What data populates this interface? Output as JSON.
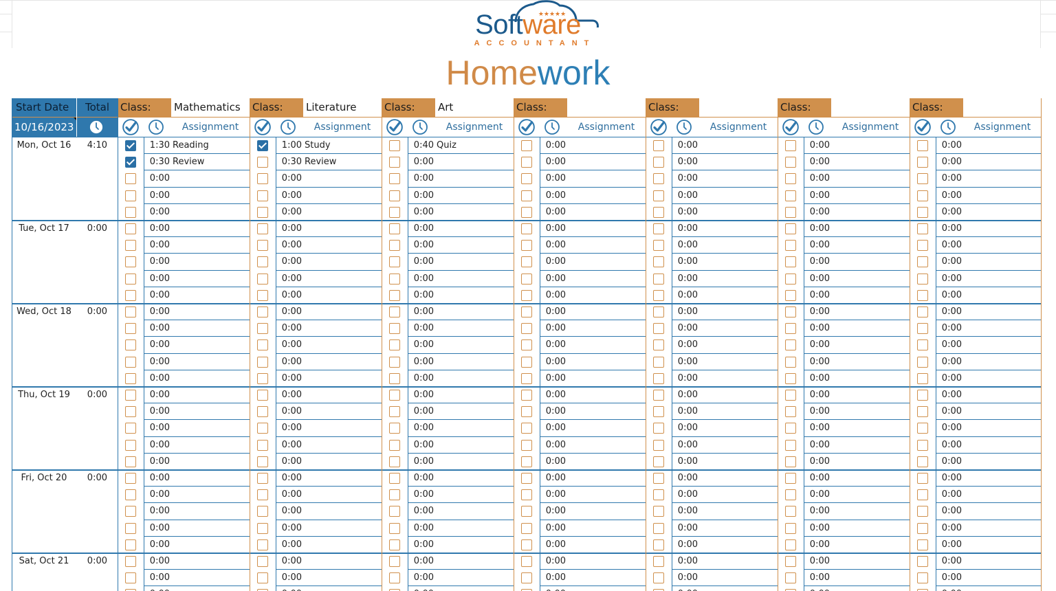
{
  "logo": {
    "word_blue": "Soft",
    "word_orange": "ware",
    "sub": "ACCOUNTANT"
  },
  "title": {
    "part1": "Home",
    "part2": "work"
  },
  "header": {
    "start_date_label": "Start Date",
    "total_label": "Total",
    "start_date_value": "10/16/2023"
  },
  "class_label": "Class:",
  "assignment_label": "Assignment",
  "classes": [
    "Mathematics",
    "Literature",
    "Art",
    "",
    "",
    "",
    ""
  ],
  "days": [
    {
      "label": "Mon, Oct 16",
      "total": "4:10"
    },
    {
      "label": "Tue, Oct 17",
      "total": "0:00"
    },
    {
      "label": "Wed, Oct 18",
      "total": "0:00"
    },
    {
      "label": "Thu, Oct 19",
      "total": "0:00"
    },
    {
      "label": "Fri, Oct 20",
      "total": "0:00"
    },
    {
      "label": "Sat, Oct 21",
      "total": "0:00"
    }
  ],
  "default_time": "0:00",
  "entries": [
    {
      "day": 0,
      "row": 0,
      "cls": 0,
      "done": true,
      "time": "1:30",
      "text": "Reading"
    },
    {
      "day": 0,
      "row": 1,
      "cls": 0,
      "done": true,
      "time": "0:30",
      "text": "Review"
    },
    {
      "day": 0,
      "row": 0,
      "cls": 1,
      "done": true,
      "time": "1:00",
      "text": "Study"
    },
    {
      "day": 0,
      "row": 1,
      "cls": 1,
      "done": false,
      "time": "0:30",
      "text": "Review"
    },
    {
      "day": 0,
      "row": 0,
      "cls": 2,
      "done": false,
      "time": "0:40",
      "text": "Quiz"
    }
  ],
  "colors": {
    "blue": "#2f78ad",
    "orange": "#d0904c",
    "dark_blue": "#1c5a8c",
    "accent_orange": "#e07b2b"
  },
  "icons": {
    "logo": "cloud-stars-icon",
    "check": "check-circle-icon",
    "clock": "clock-icon"
  }
}
